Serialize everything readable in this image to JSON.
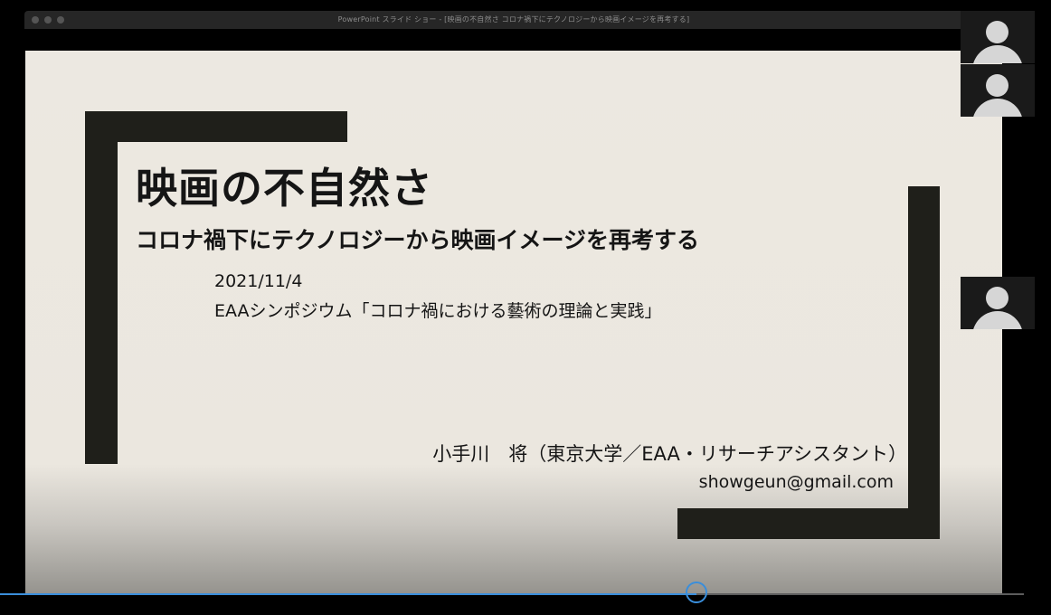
{
  "window": {
    "title": "PowerPoint スライド ショー - [映画の不自然さ コロナ禍下にテクノロジーから映画イメージを再考する]"
  },
  "slide": {
    "title": "映画の不自然さ",
    "subtitle": "コロナ禍下にテクノロジーから映画イメージを再考する",
    "date": "2021/11/4",
    "event": "EAAシンポジウム「コロナ禍における藝術の理論と実践」",
    "author": "小手川　将（東京大学／EAA・リサーチアシスタント）",
    "email": "showgeun@gmail.com"
  },
  "participants": [
    {
      "icon": "user-avatar-icon"
    },
    {
      "icon": "user-avatar-icon"
    },
    {
      "icon": "user-avatar-icon"
    }
  ],
  "playback": {
    "progress": 0.68,
    "accent_color": "#3a8edb"
  }
}
